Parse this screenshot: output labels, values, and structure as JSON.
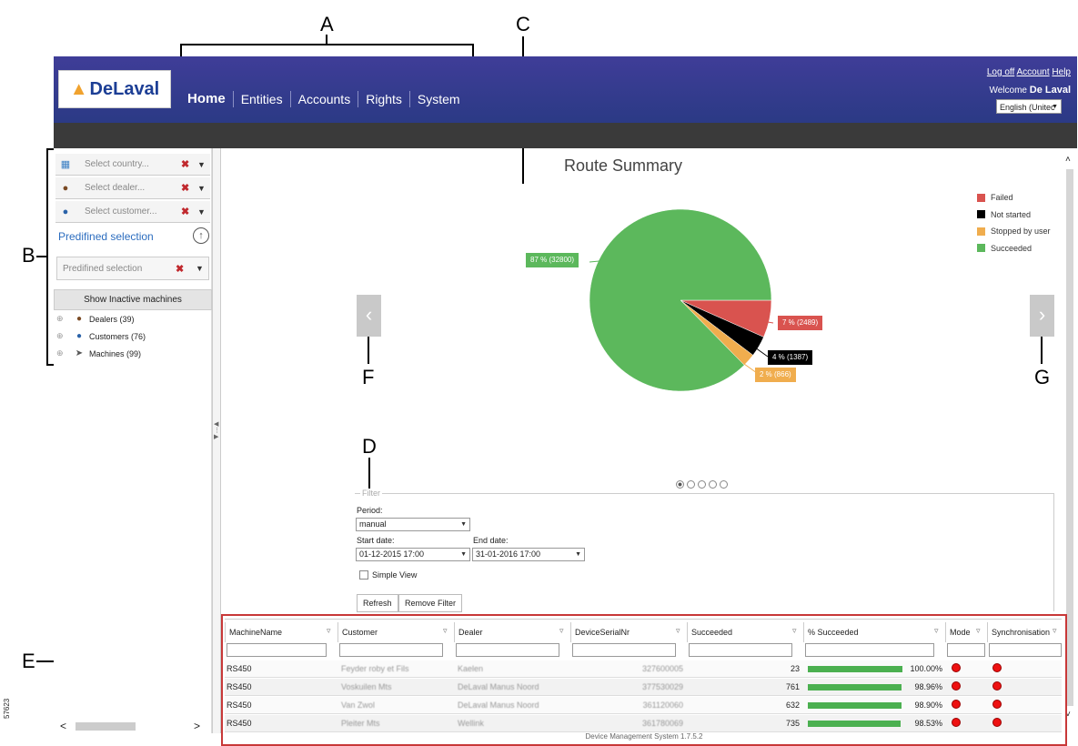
{
  "callouts": {
    "A": "A",
    "B": "B",
    "C": "C",
    "D": "D",
    "E": "E",
    "F": "F",
    "G": "G"
  },
  "side_code": "57623",
  "header": {
    "logo_text": "DeLaval",
    "nav": [
      "Home",
      "Entities",
      "Accounts",
      "Rights",
      "System"
    ],
    "links": [
      "Log off",
      "Account",
      "Help"
    ],
    "welcome_prefix": "Welcome",
    "welcome_user": "De Laval",
    "language": "English (Unitec"
  },
  "left_panel": {
    "country_placeholder": "Select country...",
    "dealer_placeholder": "Select dealer...",
    "customer_placeholder": "Select customer...",
    "predefined_title": "Predifined selection",
    "predefined_placeholder": "Predifined selection",
    "show_inactive": "Show Inactive machines",
    "tree": [
      {
        "label": "Dealers (39)",
        "icon": "dealer-icon"
      },
      {
        "label": "Customers (76)",
        "icon": "customer-icon"
      },
      {
        "label": "Machines (99)",
        "icon": "machine-icon"
      }
    ]
  },
  "chart_data": {
    "type": "pie",
    "title": "Route Summary",
    "series": [
      {
        "name": "Failed",
        "value": 2489,
        "percent": 7,
        "label": "7 % (2489)",
        "color": "#d9534f"
      },
      {
        "name": "Not started",
        "value": 1387,
        "percent": 4,
        "label": "4 % (1387)",
        "color": "#000000"
      },
      {
        "name": "Stopped by user",
        "value": 866,
        "percent": 2,
        "label": "2 % (866)",
        "color": "#f0ad4e"
      },
      {
        "name": "Succeeded",
        "value": 32800,
        "percent": 87,
        "label": "87 % (32800)",
        "color": "#5cb85c"
      }
    ],
    "legend_position": "top-right",
    "carousel_pages": 5,
    "carousel_active": 1
  },
  "filter": {
    "legend": "Filter",
    "period_label": "Period:",
    "period_value": "manual",
    "start_label": "Start date:",
    "start_value": "01-12-2015 17:00",
    "end_label": "End date:",
    "end_value": "31-01-2016 17:00",
    "simple_view": "Simple View",
    "refresh": "Refresh",
    "remove_filter": "Remove Filter"
  },
  "grid": {
    "columns": [
      "MachineName",
      "Customer",
      "Dealer",
      "DeviceSerialNr",
      "Succeeded",
      "% Succeeded",
      "Mode",
      "Synchronisation"
    ],
    "rows": [
      {
        "machine": "RS450",
        "customer": "Feyder roby et Fils",
        "dealer": "Kaelen",
        "serial": "327600005",
        "succeeded": "23",
        "percent": "100.00%",
        "fill": 1.0
      },
      {
        "machine": "RS450",
        "customer": "Voskuilen Mts",
        "dealer": "DeLaval Manus Noord",
        "serial": "377530029",
        "succeeded": "761",
        "percent": "98.96%",
        "fill": 0.9896
      },
      {
        "machine": "RS450",
        "customer": "Van Zwol",
        "dealer": "DeLaval Manus Noord",
        "serial": "361120060",
        "succeeded": "632",
        "percent": "98.90%",
        "fill": 0.989
      },
      {
        "machine": "RS450",
        "customer": "Pleiter Mts",
        "dealer": "Wellink",
        "serial": "361780069",
        "succeeded": "735",
        "percent": "98.53%",
        "fill": 0.9853
      }
    ],
    "footer": "Device Management System 1.7.5.2"
  }
}
